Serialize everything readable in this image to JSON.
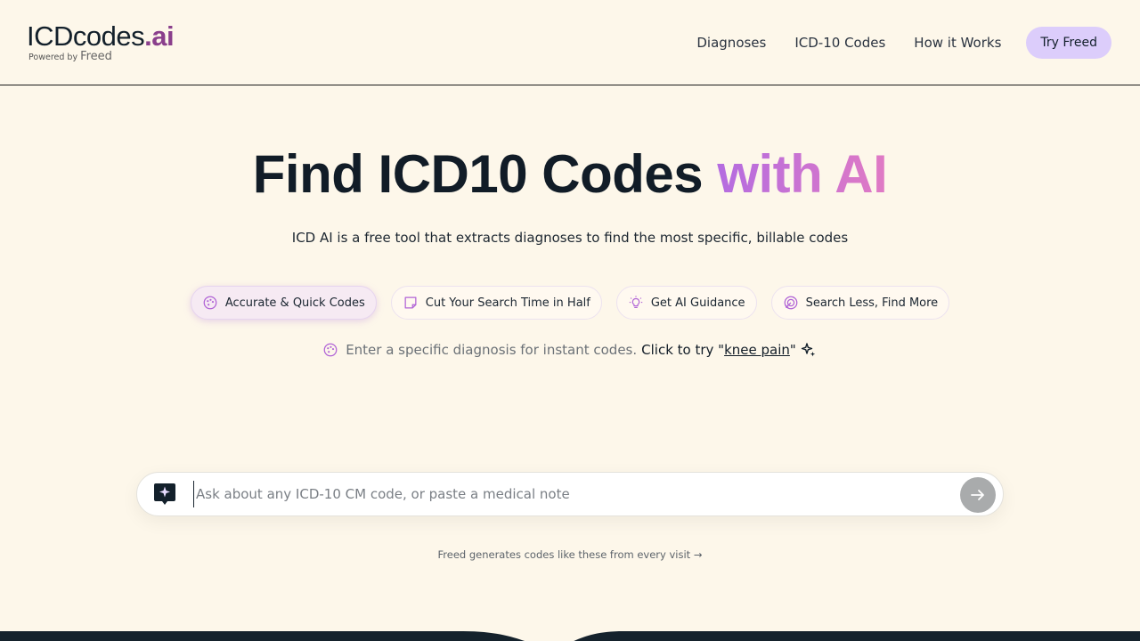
{
  "header": {
    "logo_main": "ICDcodes",
    "logo_accent": ".ai",
    "logo_sub_prefix": "Powered by",
    "logo_sub_brand": "Freed",
    "nav": [
      {
        "label": "Diagnoses"
      },
      {
        "label": "ICD-10 Codes"
      },
      {
        "label": "How it Works"
      }
    ],
    "cta_label": "Try Freed"
  },
  "hero": {
    "title": "Find ICD10 Codes",
    "title_accent": "with AI",
    "subtitle": "ICD AI is a free tool that extracts diagnoses to find the most specific, billable codes"
  },
  "chips": [
    {
      "label": "Accurate & Quick Codes",
      "icon": "palette-icon",
      "active": true
    },
    {
      "label": "Cut Your Search Time in Half",
      "icon": "note-icon",
      "active": false
    },
    {
      "label": "Get AI Guidance",
      "icon": "lightbulb-icon",
      "active": false
    },
    {
      "label": "Search Less, Find More",
      "icon": "target-icon",
      "active": false
    }
  ],
  "hint": {
    "muted": "Enter a specific diagnosis for instant codes.",
    "dark_prefix": "Click to try \"",
    "link": "knee pain",
    "dark_suffix": "\""
  },
  "search": {
    "value": "",
    "placeholder": "Ask about any ICD-10 CM code, or paste a medical note"
  },
  "footnote": "Freed generates codes like these from every visit →",
  "colors": {
    "background": "#fdf7ea",
    "accent_purple": "#b46ce0",
    "cta_bg": "#dccdfb",
    "dark_band": "#15222c"
  }
}
